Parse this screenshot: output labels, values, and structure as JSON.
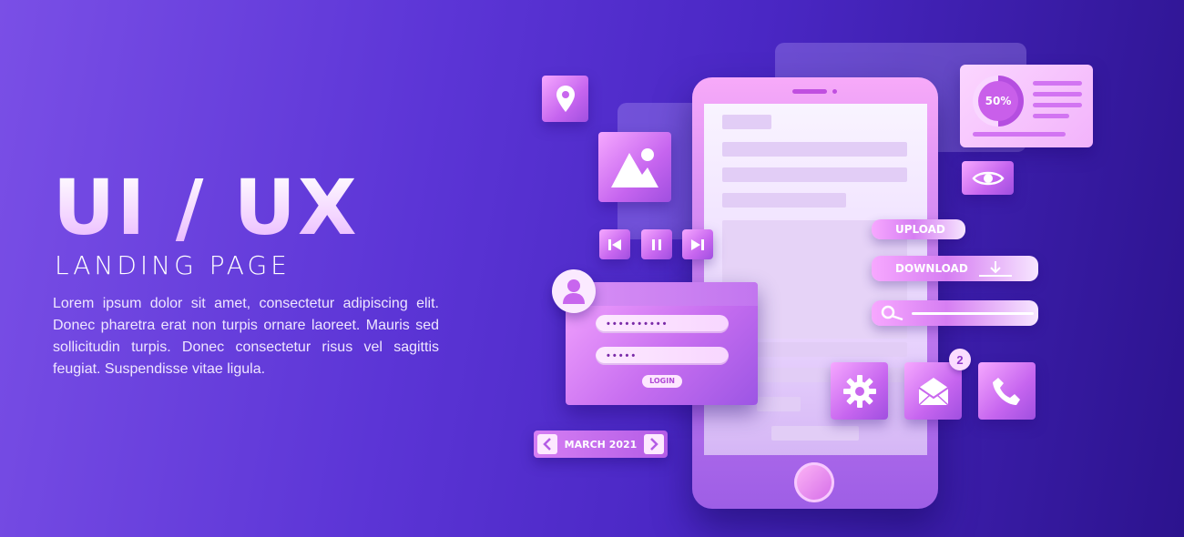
{
  "hero": {
    "title": "UI / UX",
    "subtitle": "LANDING PAGE",
    "body": "Lorem ipsum dolor sit amet, consectetur adipiscing elit. Donec pharetra erat non turpis ornare laoreet. Mauris sed sollicitudin turpis. Donec consectetur risus vel sagittis feugiat. Suspendisse vitae ligula."
  },
  "stats": {
    "percent_label": "50%",
    "progress": 0.5
  },
  "actions": {
    "upload_label": "UPLOAD",
    "download_label": "DOWNLOAD"
  },
  "login": {
    "password1_mask": "••••••••••",
    "password2_mask": "•••••",
    "button_label": "LOGIN"
  },
  "calendar": {
    "month_label": "MARCH 2021"
  },
  "mail": {
    "badge_count": "2"
  },
  "icons": {
    "location": "location-pin-icon",
    "image": "image-icon",
    "eye": "eye-icon",
    "search": "search-icon",
    "gear": "gear-icon",
    "mail": "mail-icon",
    "phone": "phone-icon",
    "user": "user-icon"
  },
  "colors": {
    "accent": "#c86ff0",
    "bg_start": "#7a4fe6",
    "bg_end": "#2c138e"
  }
}
